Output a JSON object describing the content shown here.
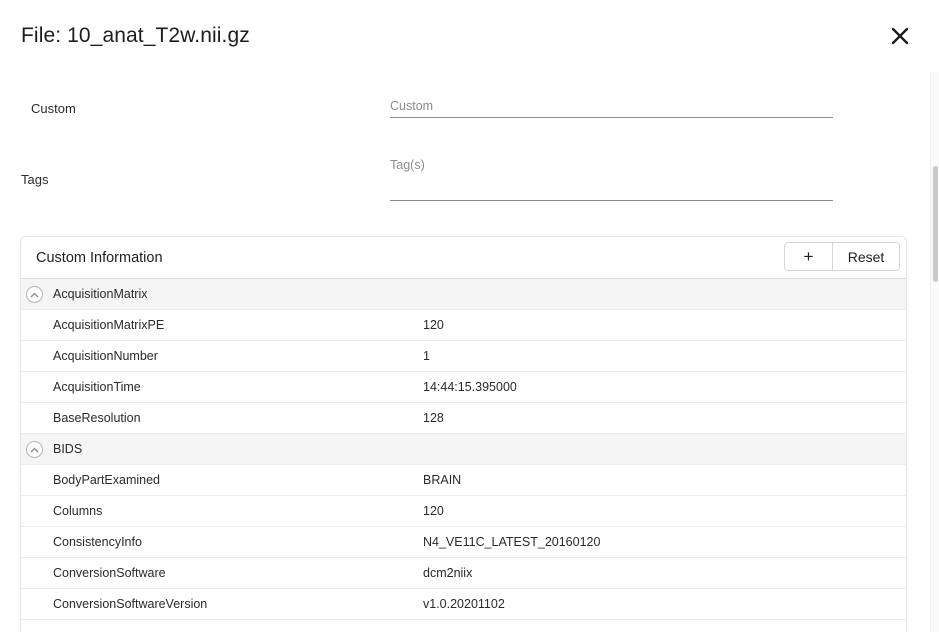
{
  "dialog": {
    "title": "File: 10_anat_T2w.nii.gz"
  },
  "fields": {
    "custom": {
      "label": "Custom",
      "placeholder": "Custom"
    },
    "tags": {
      "label": "Tags",
      "placeholder": "Tag(s)"
    }
  },
  "custom_info": {
    "title": "Custom Information",
    "add_label": "+",
    "reset_label": "Reset",
    "rows": [
      {
        "kind": "group",
        "key": "AcquisitionMatrix",
        "value": ""
      },
      {
        "kind": "item",
        "key": "AcquisitionMatrixPE",
        "value": "120"
      },
      {
        "kind": "item",
        "key": "AcquisitionNumber",
        "value": "1"
      },
      {
        "kind": "item",
        "key": "AcquisitionTime",
        "value": "14:44:15.395000"
      },
      {
        "kind": "item",
        "key": "BaseResolution",
        "value": "128"
      },
      {
        "kind": "group",
        "key": "BIDS",
        "value": ""
      },
      {
        "kind": "item",
        "key": "BodyPartExamined",
        "value": "BRAIN"
      },
      {
        "kind": "item",
        "key": "Columns",
        "value": "120"
      },
      {
        "kind": "item",
        "key": "ConsistencyInfo",
        "value": "N4_VE11C_LATEST_20160120"
      },
      {
        "kind": "item",
        "key": "ConversionSoftware",
        "value": "dcm2niix"
      },
      {
        "kind": "item",
        "key": "ConversionSoftwareVersion",
        "value": "v1.0.20201102"
      }
    ]
  },
  "icons": {
    "close": "close-icon",
    "group_toggle": "chevron-up-icon"
  }
}
